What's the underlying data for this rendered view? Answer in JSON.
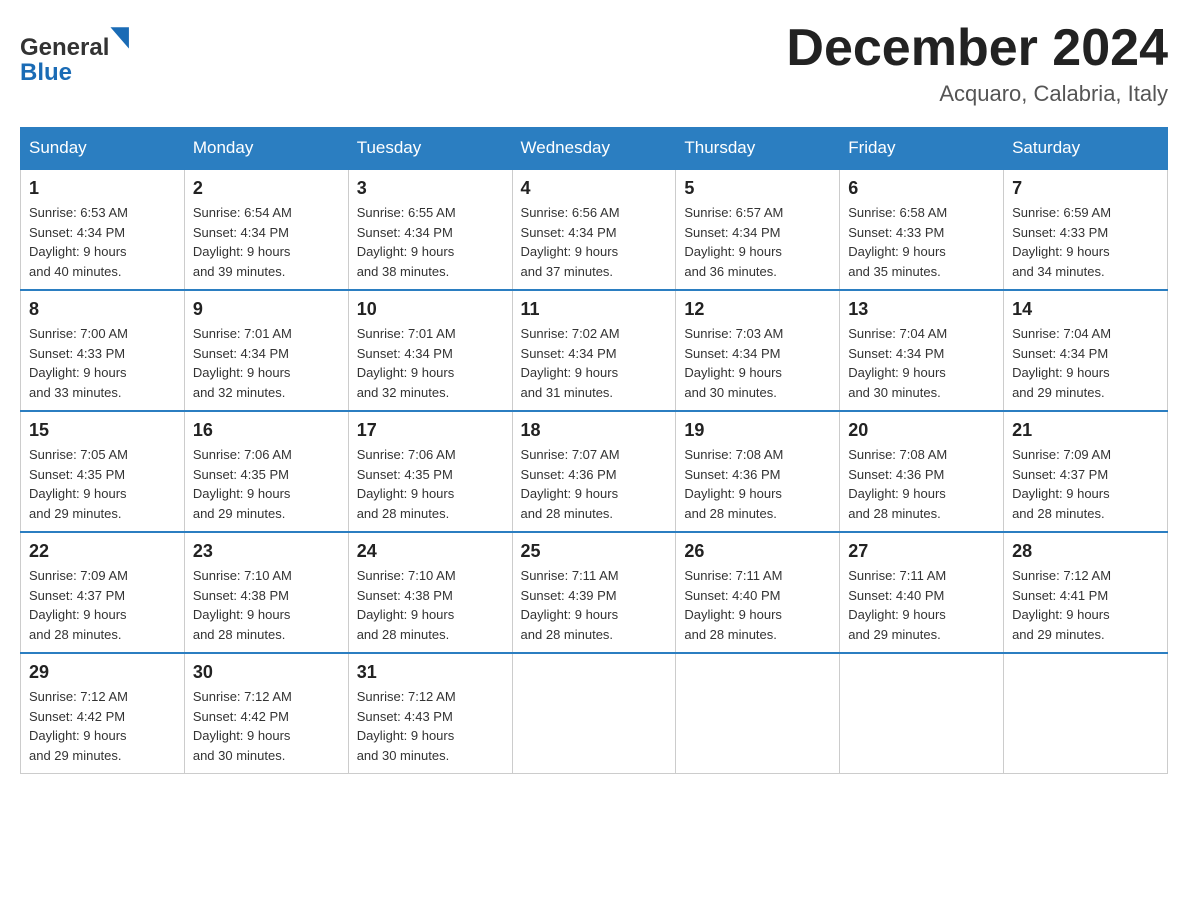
{
  "header": {
    "logo_line1": "General",
    "logo_line2": "Blue",
    "month_title": "December 2024",
    "location": "Acquaro, Calabria, Italy"
  },
  "weekdays": [
    "Sunday",
    "Monday",
    "Tuesday",
    "Wednesday",
    "Thursday",
    "Friday",
    "Saturday"
  ],
  "weeks": [
    [
      {
        "day": "1",
        "sunrise": "6:53 AM",
        "sunset": "4:34 PM",
        "daylight": "9 hours and 40 minutes."
      },
      {
        "day": "2",
        "sunrise": "6:54 AM",
        "sunset": "4:34 PM",
        "daylight": "9 hours and 39 minutes."
      },
      {
        "day": "3",
        "sunrise": "6:55 AM",
        "sunset": "4:34 PM",
        "daylight": "9 hours and 38 minutes."
      },
      {
        "day": "4",
        "sunrise": "6:56 AM",
        "sunset": "4:34 PM",
        "daylight": "9 hours and 37 minutes."
      },
      {
        "day": "5",
        "sunrise": "6:57 AM",
        "sunset": "4:34 PM",
        "daylight": "9 hours and 36 minutes."
      },
      {
        "day": "6",
        "sunrise": "6:58 AM",
        "sunset": "4:33 PM",
        "daylight": "9 hours and 35 minutes."
      },
      {
        "day": "7",
        "sunrise": "6:59 AM",
        "sunset": "4:33 PM",
        "daylight": "9 hours and 34 minutes."
      }
    ],
    [
      {
        "day": "8",
        "sunrise": "7:00 AM",
        "sunset": "4:33 PM",
        "daylight": "9 hours and 33 minutes."
      },
      {
        "day": "9",
        "sunrise": "7:01 AM",
        "sunset": "4:34 PM",
        "daylight": "9 hours and 32 minutes."
      },
      {
        "day": "10",
        "sunrise": "7:01 AM",
        "sunset": "4:34 PM",
        "daylight": "9 hours and 32 minutes."
      },
      {
        "day": "11",
        "sunrise": "7:02 AM",
        "sunset": "4:34 PM",
        "daylight": "9 hours and 31 minutes."
      },
      {
        "day": "12",
        "sunrise": "7:03 AM",
        "sunset": "4:34 PM",
        "daylight": "9 hours and 30 minutes."
      },
      {
        "day": "13",
        "sunrise": "7:04 AM",
        "sunset": "4:34 PM",
        "daylight": "9 hours and 30 minutes."
      },
      {
        "day": "14",
        "sunrise": "7:04 AM",
        "sunset": "4:34 PM",
        "daylight": "9 hours and 29 minutes."
      }
    ],
    [
      {
        "day": "15",
        "sunrise": "7:05 AM",
        "sunset": "4:35 PM",
        "daylight": "9 hours and 29 minutes."
      },
      {
        "day": "16",
        "sunrise": "7:06 AM",
        "sunset": "4:35 PM",
        "daylight": "9 hours and 29 minutes."
      },
      {
        "day": "17",
        "sunrise": "7:06 AM",
        "sunset": "4:35 PM",
        "daylight": "9 hours and 28 minutes."
      },
      {
        "day": "18",
        "sunrise": "7:07 AM",
        "sunset": "4:36 PM",
        "daylight": "9 hours and 28 minutes."
      },
      {
        "day": "19",
        "sunrise": "7:08 AM",
        "sunset": "4:36 PM",
        "daylight": "9 hours and 28 minutes."
      },
      {
        "day": "20",
        "sunrise": "7:08 AM",
        "sunset": "4:36 PM",
        "daylight": "9 hours and 28 minutes."
      },
      {
        "day": "21",
        "sunrise": "7:09 AM",
        "sunset": "4:37 PM",
        "daylight": "9 hours and 28 minutes."
      }
    ],
    [
      {
        "day": "22",
        "sunrise": "7:09 AM",
        "sunset": "4:37 PM",
        "daylight": "9 hours and 28 minutes."
      },
      {
        "day": "23",
        "sunrise": "7:10 AM",
        "sunset": "4:38 PM",
        "daylight": "9 hours and 28 minutes."
      },
      {
        "day": "24",
        "sunrise": "7:10 AM",
        "sunset": "4:38 PM",
        "daylight": "9 hours and 28 minutes."
      },
      {
        "day": "25",
        "sunrise": "7:11 AM",
        "sunset": "4:39 PM",
        "daylight": "9 hours and 28 minutes."
      },
      {
        "day": "26",
        "sunrise": "7:11 AM",
        "sunset": "4:40 PM",
        "daylight": "9 hours and 28 minutes."
      },
      {
        "day": "27",
        "sunrise": "7:11 AM",
        "sunset": "4:40 PM",
        "daylight": "9 hours and 29 minutes."
      },
      {
        "day": "28",
        "sunrise": "7:12 AM",
        "sunset": "4:41 PM",
        "daylight": "9 hours and 29 minutes."
      }
    ],
    [
      {
        "day": "29",
        "sunrise": "7:12 AM",
        "sunset": "4:42 PM",
        "daylight": "9 hours and 29 minutes."
      },
      {
        "day": "30",
        "sunrise": "7:12 AM",
        "sunset": "4:42 PM",
        "daylight": "9 hours and 30 minutes."
      },
      {
        "day": "31",
        "sunrise": "7:12 AM",
        "sunset": "4:43 PM",
        "daylight": "9 hours and 30 minutes."
      },
      null,
      null,
      null,
      null
    ]
  ],
  "labels": {
    "sunrise": "Sunrise:",
    "sunset": "Sunset:",
    "daylight": "Daylight:"
  }
}
